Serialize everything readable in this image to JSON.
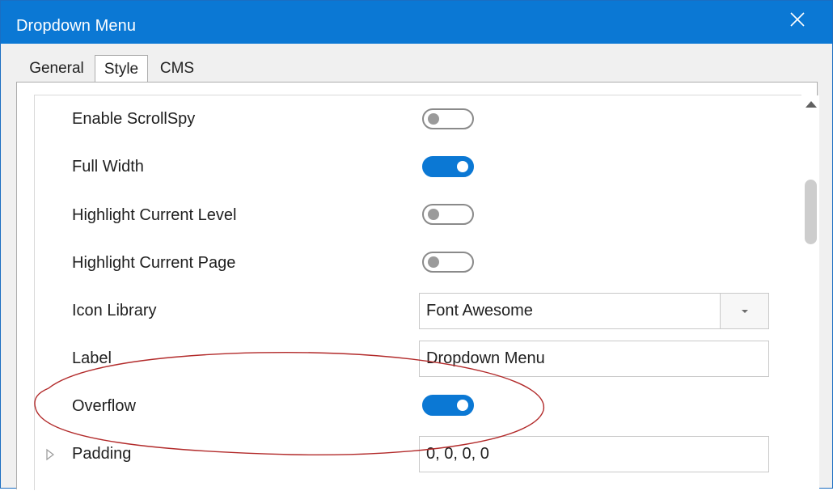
{
  "window": {
    "title": "Dropdown Menu"
  },
  "tabs": [
    {
      "label": "General"
    },
    {
      "label": "Style"
    },
    {
      "label": "CMS"
    }
  ],
  "properties": [
    {
      "label": "Enable ScrollSpy",
      "type": "toggle",
      "on": false
    },
    {
      "label": "Full Width",
      "type": "toggle",
      "on": true
    },
    {
      "label": "Highlight Current Level",
      "type": "toggle",
      "on": false
    },
    {
      "label": "Highlight Current Page",
      "type": "toggle",
      "on": false
    },
    {
      "label": "Icon Library",
      "type": "select",
      "value": "Font Awesome"
    },
    {
      "label": "Label",
      "type": "text",
      "value": "Dropdown Menu"
    },
    {
      "label": "Overflow",
      "type": "toggle",
      "on": true
    },
    {
      "label": "Padding",
      "type": "text",
      "value": "0, 0, 0, 0",
      "expandable": true
    }
  ],
  "colors": {
    "accent": "#0b78d4",
    "annotation": "#b22a2a"
  }
}
